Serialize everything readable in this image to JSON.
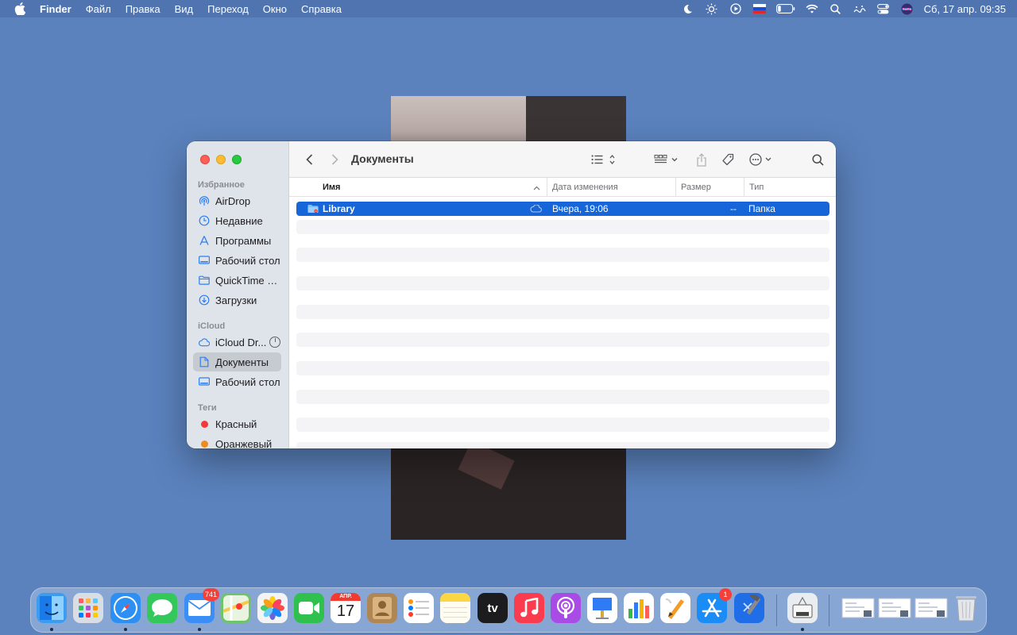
{
  "menubar": {
    "app_name": "Finder",
    "items": [
      "Файл",
      "Правка",
      "Вид",
      "Переход",
      "Окно",
      "Справка"
    ],
    "clock": "Сб, 17 апр.  09:35",
    "tray_icons": [
      "moon-icon",
      "brightness-icon",
      "play-circle-icon",
      "russian-flag-icon",
      "battery-icon",
      "wifi-icon",
      "search-icon",
      "control-strip-icon",
      "control-center-icon",
      "siri-icon"
    ]
  },
  "finder": {
    "title": "Документы",
    "sidebar": {
      "favorites_header": "Избранное",
      "favorites": [
        {
          "label": "AirDrop",
          "icon": "airdrop-icon"
        },
        {
          "label": "Недавние",
          "icon": "clock-icon"
        },
        {
          "label": "Программы",
          "icon": "applications-icon"
        },
        {
          "label": "Рабочий стол",
          "icon": "desktop-icon"
        },
        {
          "label": "QuickTime P...",
          "icon": "folder-icon"
        },
        {
          "label": "Загрузки",
          "icon": "downloads-icon"
        }
      ],
      "icloud_header": "iCloud",
      "icloud": [
        {
          "label": "iCloud Dr...",
          "icon": "icloud-icon"
        },
        {
          "label": "Документы",
          "icon": "document-icon",
          "active": true
        },
        {
          "label": "Рабочий стол",
          "icon": "desktop-icon"
        }
      ],
      "tags_header": "Теги",
      "tags": [
        {
          "label": "Красный",
          "color": "#f5393b"
        },
        {
          "label": "Оранжевый",
          "color": "#f28a1b"
        }
      ]
    },
    "columns": {
      "name": "Имя",
      "modified": "Дата изменения",
      "size": "Размер",
      "kind": "Тип"
    },
    "files": [
      {
        "name": "Library",
        "modified": "Вчера, 19:06",
        "size": "--",
        "kind": "Папка",
        "selected": true
      }
    ]
  },
  "dock": {
    "apps": [
      {
        "name": "Finder",
        "icon": "finder-icon",
        "color": "#3b9cf0",
        "running": true
      },
      {
        "name": "Launchpad",
        "icon": "launchpad-icon",
        "color": "#d9dde4"
      },
      {
        "name": "Safari",
        "icon": "safari-icon",
        "color": "#2c8ff3",
        "running": true
      },
      {
        "name": "Messages",
        "icon": "messages-icon",
        "color": "#34c759"
      },
      {
        "name": "Mail",
        "icon": "mail-icon",
        "color": "#3a8ef6",
        "badge": "741",
        "running": true
      },
      {
        "name": "Maps",
        "icon": "maps-icon",
        "color": "#6fc36a"
      },
      {
        "name": "Photos",
        "icon": "photos-icon",
        "color": "#f4f4f4"
      },
      {
        "name": "FaceTime",
        "icon": "facetime-icon",
        "color": "#2fc04e"
      },
      {
        "name": "Calendar",
        "icon": "calendar-icon",
        "color": "#ffffff",
        "month": "АПР.",
        "day": "17"
      },
      {
        "name": "Contacts",
        "icon": "contacts-icon",
        "color": "#b08752"
      },
      {
        "name": "Reminders",
        "icon": "reminders-icon",
        "color": "#ffffff"
      },
      {
        "name": "Notes",
        "icon": "notes-icon",
        "color": "#fcd745"
      },
      {
        "name": "TV",
        "icon": "appletv-icon",
        "color": "#1c1c1e",
        "text": "tv"
      },
      {
        "name": "Music",
        "icon": "music-icon",
        "color": "#fa3c4e"
      },
      {
        "name": "Podcasts",
        "icon": "podcasts-icon",
        "color": "#a94be5"
      },
      {
        "name": "Keynote",
        "icon": "keynote-icon",
        "color": "#ffffff"
      },
      {
        "name": "Numbers",
        "icon": "numbers-icon",
        "color": "#ffffff"
      },
      {
        "name": "Pages",
        "icon": "pages-icon",
        "color": "#ffffff"
      },
      {
        "name": "App Store",
        "icon": "appstore-icon",
        "color": "#1a8cf6",
        "badge": "1"
      },
      {
        "name": "Xcode",
        "icon": "xcode-icon",
        "color": "#1f6ee8"
      },
      {
        "name": "Migration Assistant",
        "icon": "migration-assistant-icon",
        "color": "#e9ecf0",
        "running": true
      },
      {
        "name": "Recent 1",
        "icon": "document-thumbnail-icon",
        "color": "#f6f7f9"
      },
      {
        "name": "Recent 2",
        "icon": "document-thumbnail-icon",
        "color": "#f6f7f9"
      },
      {
        "name": "Recent 3",
        "icon": "document-thumbnail-icon",
        "color": "#f6f7f9"
      },
      {
        "name": "Trash",
        "icon": "trash-icon",
        "color": "#e6e8eb"
      }
    ]
  }
}
